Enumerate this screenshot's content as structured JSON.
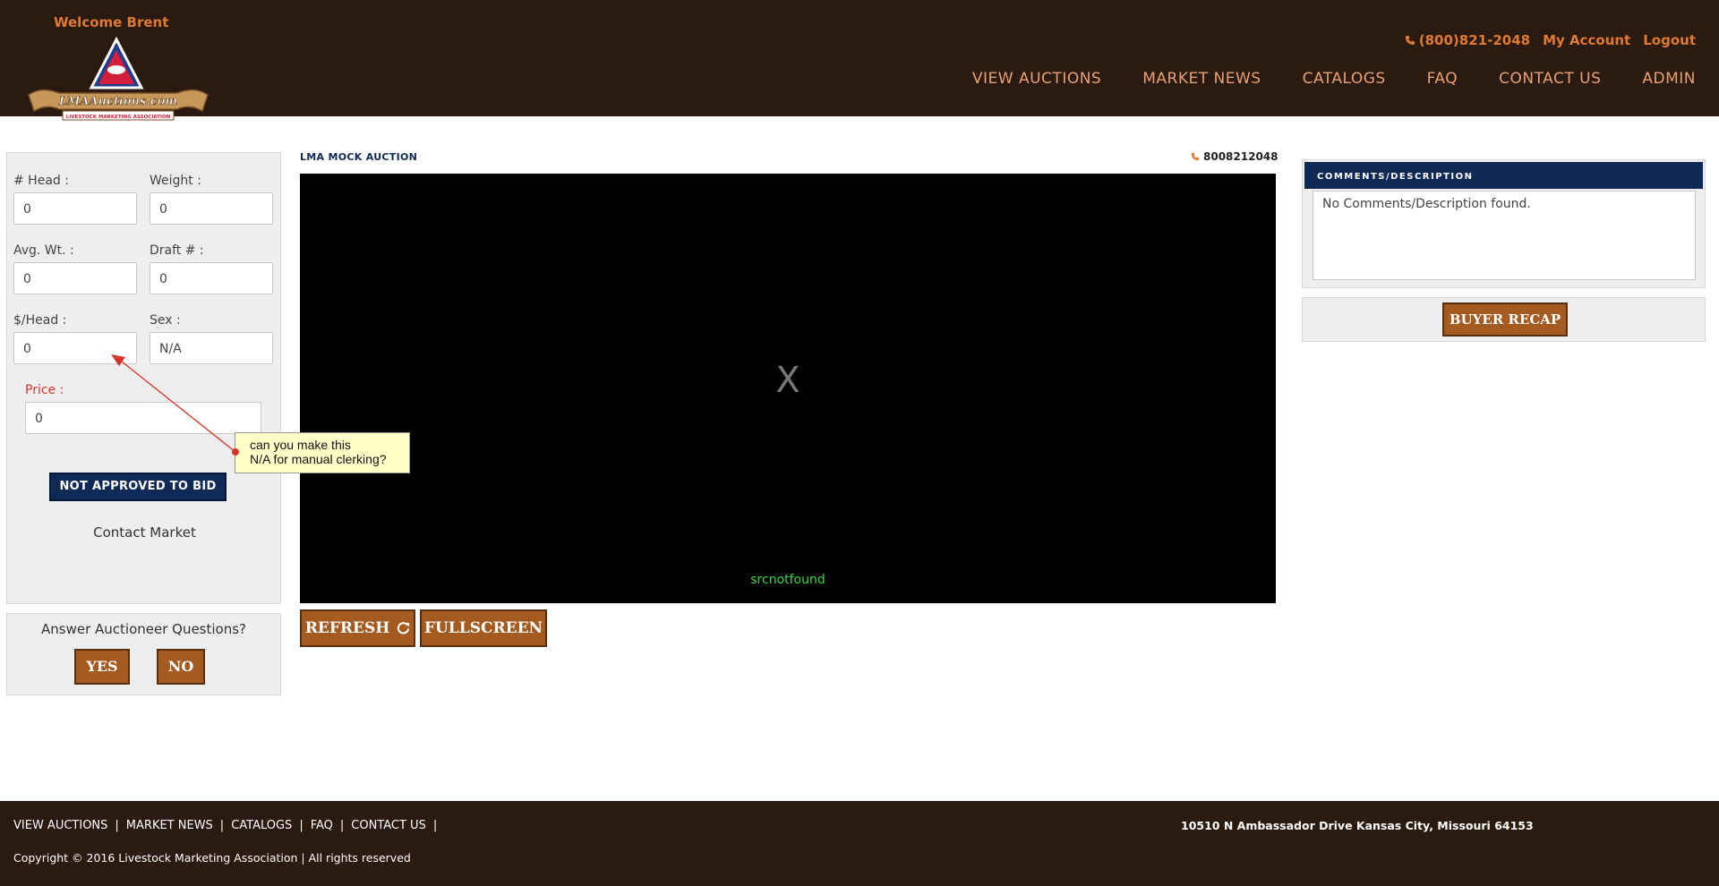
{
  "header": {
    "welcome": "Welcome Brent",
    "phone": "(800)821-2048",
    "my_account": "My Account",
    "logout": "Logout",
    "logo_text": "LMAAuctions.com",
    "logo_subtext": "LIVESTOCK MARKETING ASSOCIATION",
    "nav": [
      "VIEW AUCTIONS",
      "MARKET NEWS",
      "CATALOGS",
      "FAQ",
      "CONTACT US",
      "ADMIN"
    ]
  },
  "lot_fields": {
    "head_label": "# Head :",
    "head_value": "0",
    "weight_label": "Weight :",
    "weight_value": "0",
    "avgwt_label": "Avg. Wt. :",
    "avgwt_value": "0",
    "draft_label": "Draft # :",
    "draft_value": "0",
    "perhead_label": "$/Head :",
    "perhead_value": "0",
    "sex_label": "Sex :",
    "sex_value": "N/A",
    "price_label": "Price :",
    "price_value": "0"
  },
  "bid_status": "NOT APPROVED TO BID",
  "contact_market": "Contact Market",
  "questions": {
    "prompt": "Answer Auctioneer Questions?",
    "yes": "YES",
    "no": "NO"
  },
  "auction": {
    "title": "LMA MOCK AUCTION",
    "phone": "8008212048",
    "video_placeholder": "X",
    "video_error": "srcnotfound",
    "refresh": "REFRESH",
    "fullscreen": "FULLSCREEN"
  },
  "comments": {
    "heading": "COMMENTS/DESCRIPTION",
    "text": "No Comments/Description found.",
    "buyer_recap": "BUYER RECAP"
  },
  "annotation": {
    "line1": "can you make this",
    "line2": "N/A for manual clerking?"
  },
  "footer": {
    "nav": [
      "VIEW AUCTIONS",
      "MARKET NEWS",
      "CATALOGS",
      "FAQ",
      "CONTACT US"
    ],
    "separator": "|",
    "copyright": "Copyright © 2016 Livestock Marketing Association | All rights reserved",
    "address": "10510 N Ambassador Drive Kansas City, Missouri 64153"
  },
  "colors": {
    "header_bg": "#2a1a10",
    "accent_orange": "#e07a33",
    "navy": "#0f2a57",
    "button_brown": "#a55a1f"
  }
}
